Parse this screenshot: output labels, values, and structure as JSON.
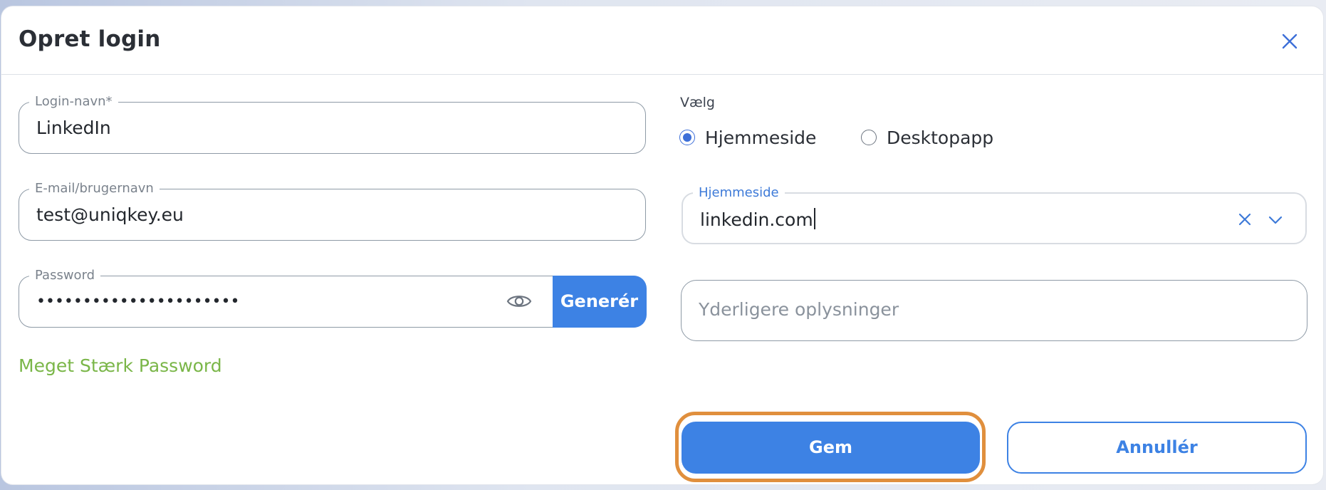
{
  "dialog": {
    "title": "Opret login"
  },
  "form": {
    "login_name": {
      "label": "Login-navn*",
      "value": "LinkedIn"
    },
    "email": {
      "label": "E-mail/brugernavn",
      "value": "test@uniqkey.eu"
    },
    "password": {
      "label": "Password",
      "masked_value": "••••••••••••••••••••••",
      "generate_label": "Generér",
      "strength_text": "Meget Stærk Password"
    },
    "type": {
      "label": "Vælg",
      "options": [
        {
          "label": "Hjemmeside",
          "selected": true
        },
        {
          "label": "Desktopapp",
          "selected": false
        }
      ]
    },
    "website": {
      "label": "Hjemmeside",
      "value": "linkedin.com"
    },
    "notes": {
      "placeholder": "Yderligere oplysninger"
    }
  },
  "actions": {
    "save_label": "Gem",
    "cancel_label": "Annullér"
  },
  "colors": {
    "accent": "#3d82e4",
    "focus_outline": "#e08f3d",
    "strength": "#7ab648",
    "radio_selected": "#3d6fd8"
  },
  "icons": {
    "close": "close-icon",
    "eye": "eye-icon",
    "clear": "clear-icon",
    "dropdown": "chevron-down-icon"
  }
}
